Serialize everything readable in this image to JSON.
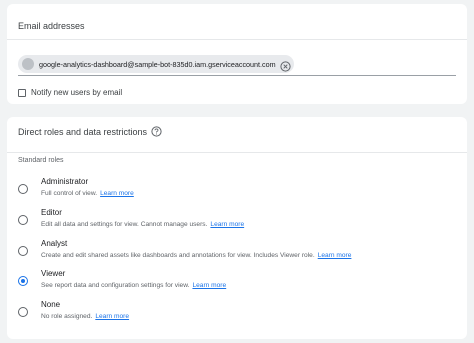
{
  "email_section": {
    "title": "Email addresses",
    "chip_email": "google-analytics-dashboard@sample-bot-835d0.iam.gserviceaccount.com",
    "notify_label": "Notify new users by email"
  },
  "roles_section": {
    "title": "Direct roles and data restrictions",
    "standard_roles_label": "Standard roles",
    "learn_more": "Learn more",
    "selected_role": "Viewer",
    "roles": [
      {
        "name": "Administrator",
        "description": "Full control of view.",
        "selected": false
      },
      {
        "name": "Editor",
        "description": "Edit all data and settings for view. Cannot manage users.",
        "selected": false
      },
      {
        "name": "Analyst",
        "description": "Create and edit shared assets like dashboards and annotations for view. Includes Viewer role.",
        "selected": false
      },
      {
        "name": "Viewer",
        "description": "See report data and configuration settings for view.",
        "selected": true
      },
      {
        "name": "None",
        "description": "No role assigned.",
        "selected": false
      }
    ]
  },
  "colors": {
    "accent": "#1a73e8",
    "background": "#f1f3f4"
  }
}
